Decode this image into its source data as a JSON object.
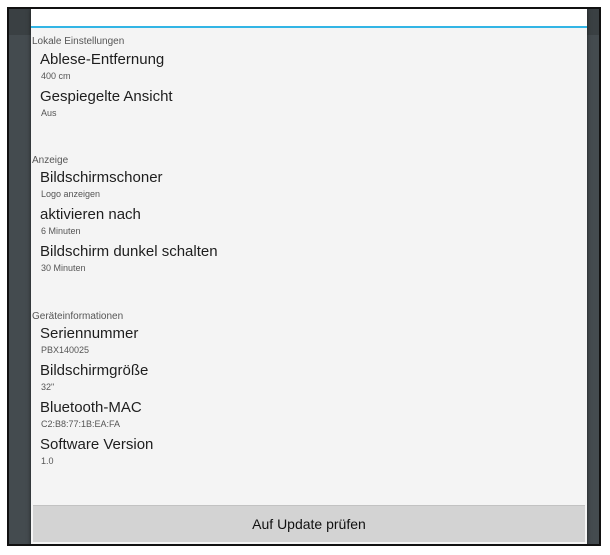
{
  "sections": [
    {
      "header": "Lokale Einstellungen",
      "items": [
        {
          "title": "Ablese-Entfernung",
          "value": "400 cm"
        },
        {
          "title": "Gespiegelte Ansicht",
          "value": "Aus"
        }
      ]
    },
    {
      "header": "Anzeige",
      "items": [
        {
          "title": "Bildschirmschoner",
          "value": "Logo anzeigen"
        },
        {
          "title": "aktivieren nach",
          "value": "6 Minuten"
        },
        {
          "title": "Bildschirm dunkel schalten",
          "value": "30 Minuten"
        }
      ]
    },
    {
      "header": "Geräteinformationen",
      "items": [
        {
          "title": "Seriennummer",
          "value": "PBX140025"
        },
        {
          "title": "Bildschirmgröße",
          "value": "32\""
        },
        {
          "title": "Bluetooth-MAC",
          "value": "C2:B8:77:1B:EA:FA"
        },
        {
          "title": "Software Version",
          "value": "1.0"
        }
      ]
    }
  ],
  "footer": {
    "update_button_label": "Auf Update prüfen"
  },
  "colors": {
    "accent": "#33b5e5",
    "dialog_bg": "#f4f4f4",
    "button_bg": "#d3d3d3"
  }
}
